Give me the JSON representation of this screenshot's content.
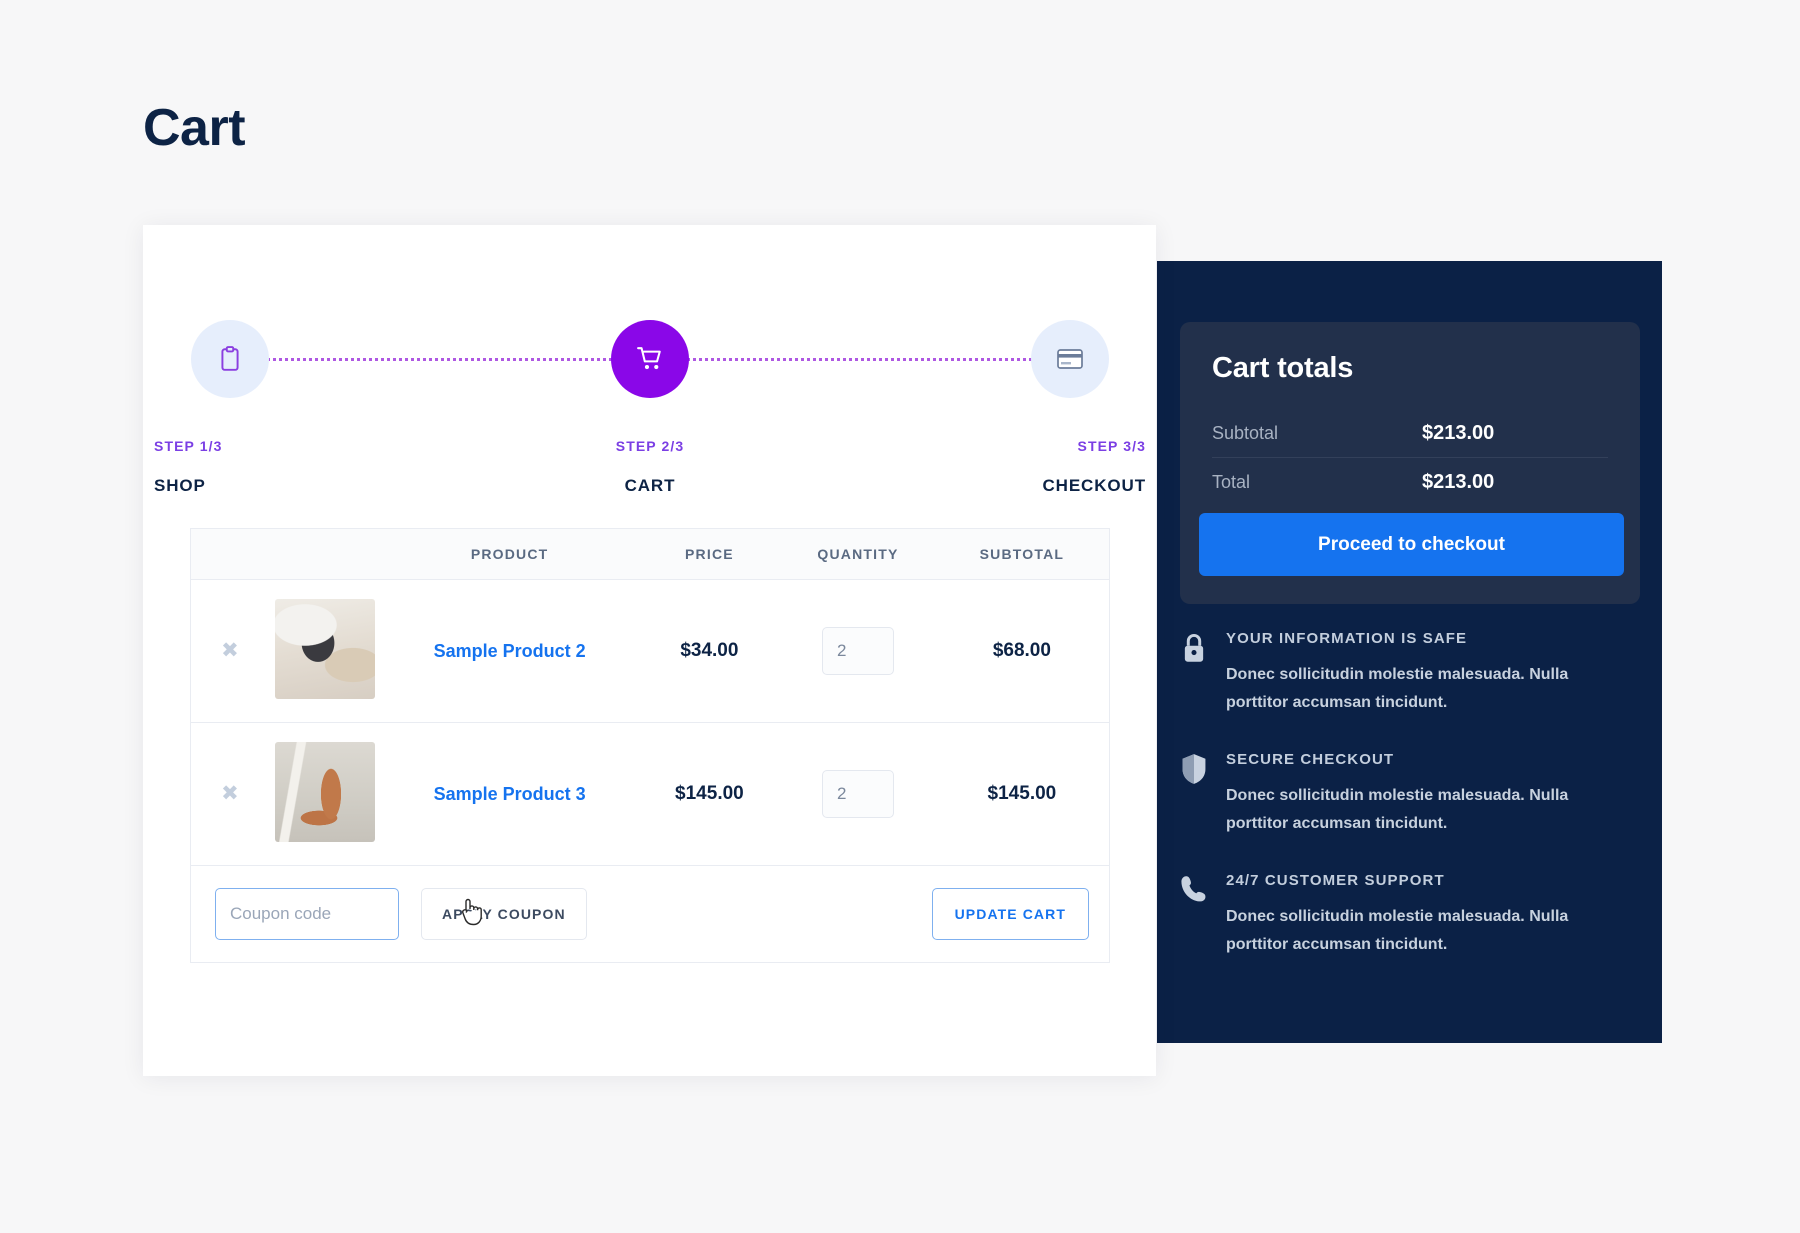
{
  "page": {
    "title": "Cart"
  },
  "steps": [
    {
      "num": "STEP 1/3",
      "name": "SHOP",
      "icon": "clipboard-icon",
      "active": false
    },
    {
      "num": "STEP 2/3",
      "name": "CART",
      "icon": "shopping-cart-icon",
      "active": true
    },
    {
      "num": "STEP 3/3",
      "name": "CHECKOUT",
      "icon": "credit-card-icon",
      "active": false
    }
  ],
  "table": {
    "headers": {
      "remove": "",
      "thumb": "",
      "product": "PRODUCT",
      "price": "PRICE",
      "quantity": "QUANTITY",
      "subtotal": "SUBTOTAL"
    },
    "rows": [
      {
        "remove_icon": "remove-item-icon",
        "name": "Sample Product 2",
        "price": "$34.00",
        "quantity": "2",
        "subtotal": "$68.00"
      },
      {
        "remove_icon": "remove-item-icon",
        "name": "Sample Product 3",
        "price": "$145.00",
        "quantity": "2",
        "subtotal": "$145.00"
      }
    ],
    "coupon_placeholder": "Coupon code",
    "coupon_value": "",
    "apply_coupon_label": "APPLY COUPON",
    "update_cart_label": "UPDATE CART"
  },
  "totals": {
    "heading": "Cart totals",
    "rows": [
      {
        "label": "Subtotal",
        "value": "$213.00"
      },
      {
        "label": "Total",
        "value": "$213.00"
      }
    ],
    "checkout_label": "Proceed to checkout"
  },
  "badges": [
    {
      "icon": "lock-icon",
      "title": "YOUR INFORMATION IS SAFE",
      "text": "Donec sollicitudin molestie malesuada. Nulla porttitor accumsan tincidunt."
    },
    {
      "icon": "shield-icon",
      "title": "SECURE CHECKOUT",
      "text": "Donec sollicitudin molestie malesuada. Nulla porttitor accumsan tincidunt."
    },
    {
      "icon": "phone-icon",
      "title": "24/7 CUSTOMER SUPPORT",
      "text": "Donec sollicitudin molestie malesuada. Nulla porttitor accumsan tincidunt."
    }
  ],
  "colors": {
    "accent_purple": "#8a07e8",
    "accent_blue": "#1573ef",
    "dark_navy": "#0b2146",
    "panel_card": "#22304b",
    "title_navy": "#0d2345"
  }
}
